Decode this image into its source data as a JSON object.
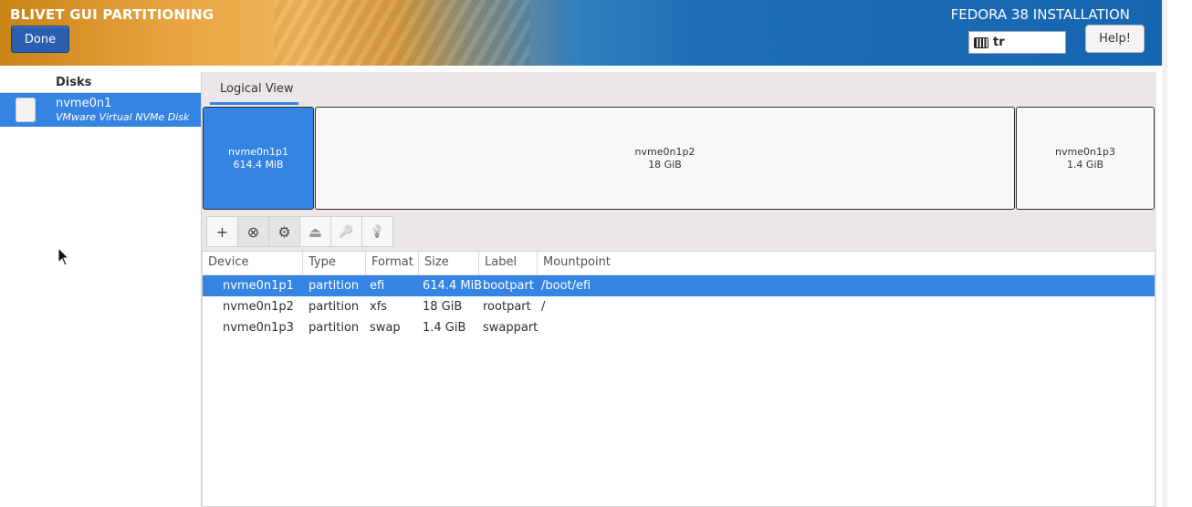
{
  "header": {
    "app_title": "BLIVET GUI PARTITIONING",
    "done_label": "Done",
    "install_title": "FEDORA 38 INSTALLATION",
    "keyboard_layout": "tr",
    "help_label": "Help!"
  },
  "sidebar": {
    "heading": "Disks",
    "disks": [
      {
        "name": "nvme0n1",
        "description": "VMware Virtual NVMe Disk"
      }
    ]
  },
  "main": {
    "tab_label": "Logical View",
    "partitions": [
      {
        "name": "nvme0n1p1",
        "size": "614.4 MiB",
        "selected": true
      },
      {
        "name": "nvme0n1p2",
        "size": "18 GiB",
        "selected": false
      },
      {
        "name": "nvme0n1p3",
        "size": "1.4 GiB",
        "selected": false
      }
    ],
    "toolbar": [
      {
        "icon": "add-icon",
        "glyph": "+"
      },
      {
        "icon": "delete-icon",
        "glyph": "⊗"
      },
      {
        "icon": "edit-icon",
        "glyph": "⚙"
      },
      {
        "icon": "unmount-icon",
        "glyph": "⏏"
      },
      {
        "icon": "decrypt-icon",
        "glyph": "🔑"
      },
      {
        "icon": "info-icon",
        "glyph": "💡"
      }
    ],
    "table": {
      "columns": [
        "Device",
        "Type",
        "Format",
        "Size",
        "Label",
        "Mountpoint"
      ],
      "rows": [
        {
          "device": "nvme0n1p1",
          "type": "partition",
          "format": "efi",
          "size": "614.4 MiB",
          "label": "bootpart",
          "mountpoint": "/boot/efi"
        },
        {
          "device": "nvme0n1p2",
          "type": "partition",
          "format": "xfs",
          "size": "18 GiB",
          "label": "rootpart",
          "mountpoint": "/"
        },
        {
          "device": "nvme0n1p3",
          "type": "partition",
          "format": "swap",
          "size": "1.4 GiB",
          "label": "swappart",
          "mountpoint": ""
        }
      ]
    }
  },
  "colors": {
    "accent": "#3584e4",
    "done_button": "#2a5fb0"
  }
}
